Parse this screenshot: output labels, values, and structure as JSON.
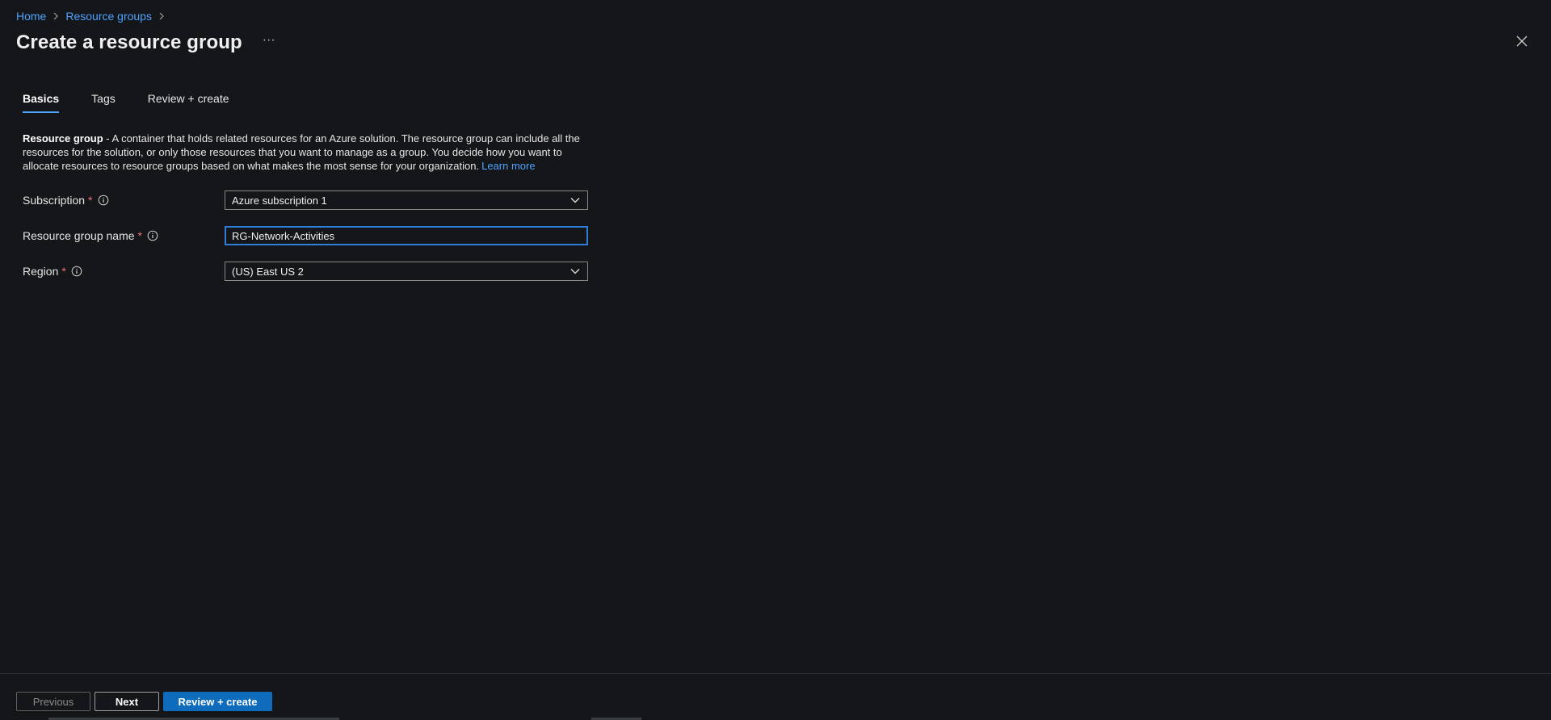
{
  "breadcrumb": {
    "home": "Home",
    "resource_groups": "Resource groups"
  },
  "header": {
    "title": "Create a resource group",
    "more": "···"
  },
  "tabs": [
    {
      "label": "Basics",
      "active": true
    },
    {
      "label": "Tags",
      "active": false
    },
    {
      "label": "Review + create",
      "active": false
    }
  ],
  "description": {
    "lead": "Resource group",
    "text": " - A container that holds related resources for an Azure solution. The resource group can include all the resources for the solution, or only those resources that you want to manage as a group. You decide how you want to allocate resources to resource groups based on what makes the most sense for your organization.",
    "link": "Learn more"
  },
  "form": {
    "subscription": {
      "label": "Subscription",
      "required": "*",
      "value": "Azure subscription 1"
    },
    "resource_group_name": {
      "label": "Resource group name",
      "required": "*",
      "value": "RG-Network-Activities"
    },
    "region": {
      "label": "Region",
      "required": "*",
      "value": "(US) East US 2"
    }
  },
  "footer": {
    "previous": "Previous",
    "next": "Next",
    "review_create": "Review + create"
  },
  "colors": {
    "background": "#141619",
    "link": "#4da3ff",
    "primary_button": "#0f6cbd",
    "required": "#f1707b",
    "focus_border": "#2f7fd6"
  },
  "icons": {
    "breadcrumb_separator": "chevron-right-icon",
    "close": "close-icon",
    "info": "info-icon",
    "dropdown": "chevron-down-icon"
  }
}
